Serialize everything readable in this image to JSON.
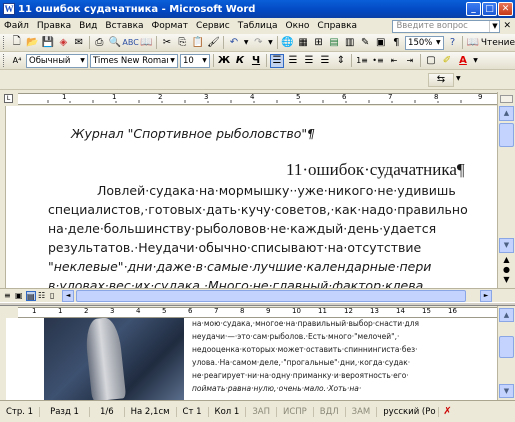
{
  "window": {
    "title": "11 ошибок судачатника - Microsoft Word",
    "app_icon_letter": "W"
  },
  "menu": {
    "items": [
      "Файл",
      "Правка",
      "Вид",
      "Вставка",
      "Формат",
      "Сервис",
      "Таблица",
      "Окно",
      "Справка"
    ],
    "ask_placeholder": "Введите вопрос"
  },
  "standard_toolbar": {
    "zoom": "150%",
    "read_label": "Чтение"
  },
  "format_toolbar": {
    "style": "Обычный",
    "font": "Times New Roman",
    "size": "10",
    "bold": "Ж",
    "italic": "К",
    "underline": "Ч"
  },
  "ruler_top": {
    "numbers": [
      "1",
      "1",
      "2",
      "3",
      "4",
      "5",
      "6",
      "7",
      "8",
      "9"
    ]
  },
  "ruler_bottom": {
    "numbers": [
      "1",
      "1",
      "2",
      "3",
      "4",
      "5",
      "6",
      "7",
      "8",
      "9",
      "10",
      "11",
      "12",
      "13",
      "14",
      "15",
      "16"
    ]
  },
  "document_top": {
    "journal": "Журнал \"Спортивное рыболовство\"¶",
    "heading": "11·ошибок·судачатника¶",
    "lines": [
      "Ловлей·судака·на·мормышку··уже·никого·не·удивишь",
      "специалистов,·готовых·дать·кучу·советов,·как·надо·правильно",
      "на·деле·большинству·рыболовов·не·каждый·день·удается",
      "результатов.·Неудачи·обычно·списывают·на·отсутствие",
      "\"неклевые\"·дни·даже·в·самые·лучшие·календарные·пери",
      "в·уловах·вес·их·судака.·Много·не·главный·фактор·клева"
    ]
  },
  "document_bottom": {
    "lines": [
      "на·мою·судака,·многое·на·правильный·выбор·снасти·для",
      "неудачи·—·это·сам·рыболов.·Есть·много·\"мелочей\",·",
      "недооценка·которых·может·оставить·спиннингиста·без·",
      "улова.·На·самом·деле,·\"прогальные\"·дни,·когда·судак·",
      "не·реагирует·ни·на·одну·приманку·и·вероятность·его·",
      "поймать·равна·нулю,·очень·мало.·Хоть·на·"
    ]
  },
  "status": {
    "page": "Стр. 1",
    "section": "Разд 1",
    "pages": "1/6",
    "at": "На 2,1см",
    "line": "Ст 1",
    "col": "Кол 1",
    "rec": "ЗАП",
    "trk": "ИСПР",
    "ext": "ВДЛ",
    "ovr": "ЗАМ",
    "lang": "русский (Ро"
  }
}
